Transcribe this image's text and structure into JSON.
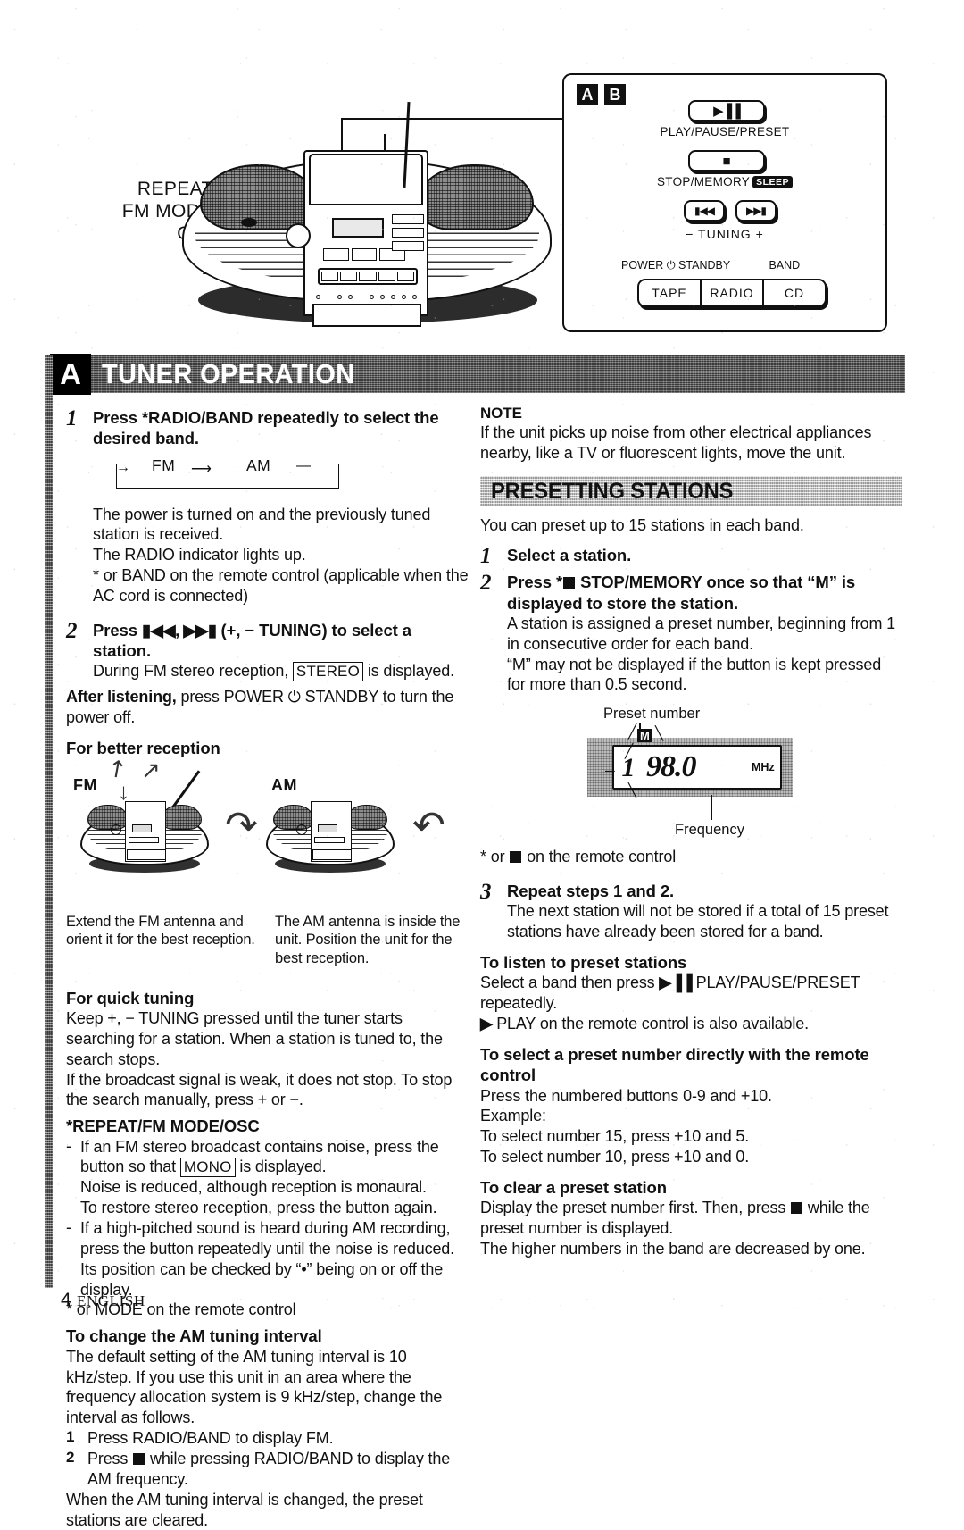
{
  "page": {
    "number": "4",
    "language": "ENGLISH"
  },
  "diagram": {
    "unit_callouts": [
      {
        "name": "repeat-fm-mode-osc",
        "text": "REPEAT/\nFM MODE/\nOSC"
      },
      {
        "name": "headphone-jack",
        "text": "๏"
      }
    ],
    "panel": {
      "badges": [
        "A",
        "B"
      ],
      "keys": [
        {
          "name": "play-pause-preset",
          "glyph": "▶▐▐",
          "caption": "PLAY/PAUSE/PRESET"
        },
        {
          "name": "stop-memory",
          "glyph": "■",
          "caption": "STOP/MEMORY",
          "badge": "SLEEP"
        },
        {
          "name": "tuning-down",
          "glyph": "▮◀◀"
        },
        {
          "name": "tuning-up",
          "glyph": "▶▶▮"
        }
      ],
      "tuning_caption": {
        "minus": "−",
        "label": "TUNING",
        "plus": "+"
      },
      "power_label": "POWER ⏻ STANDBY",
      "band_label": "BAND",
      "source_buttons": [
        "TAPE",
        "RADIO",
        "CD"
      ]
    }
  },
  "section": {
    "badge": "A",
    "title": "TUNER OPERATION"
  },
  "left": {
    "step1": {
      "num": "1",
      "heading": "Press *RADIO/BAND repeatedly to select the desired band.",
      "band_cycle": {
        "fm": "FM",
        "am": "AM"
      },
      "body1": "The power is turned on and the previously tuned station is received.",
      "body2": "The RADIO indicator lights up.",
      "body3": "* or BAND on the remote control (applicable when the AC cord is connected)"
    },
    "step2": {
      "num": "2",
      "heading_pre": "Press ",
      "heading_syms": "▮◀◀, ▶▶▮",
      "heading_post": " (+, − TUNING)  to select a station.",
      "body": "During FM stereo reception, ",
      "boxed": "STEREO",
      "body_after": " is displayed."
    },
    "after_listening": {
      "bold": "After listening,",
      "rest": " press POWER ⏻ STANDBY to turn the power off."
    },
    "better_reception": {
      "heading": "For better reception",
      "fm_label": "FM",
      "am_label": "AM",
      "fm_caption": "Extend the FM antenna and orient it for the best reception.",
      "am_caption": "The AM antenna is inside the unit. Position the unit for the best reception."
    },
    "quick_tuning": {
      "heading": "For quick tuning",
      "body1": "Keep +, − TUNING pressed until the tuner starts searching for a station. When a station is tuned to, the search stops.",
      "body2": "If the broadcast signal is weak, it does not stop. To stop the search manually, press + or −."
    },
    "repeat_mode": {
      "heading": "*REPEAT/FM MODE/OSC",
      "bullet1_a": "If an FM stereo broadcast contains noise, press the button so that ",
      "bullet1_boxed": "MONO",
      "bullet1_b": " is displayed.",
      "bullet1_c": "Noise is reduced, although reception is monaural.",
      "bullet1_d": "To restore stereo reception, press the button again.",
      "bullet2": "If a high-pitched sound is heard during AM recording, press the button repeatedly until the noise is reduced.  Its position can be checked by “•” being on or off the display.",
      "note": "* or MODE on the remote control"
    },
    "am_interval": {
      "heading": "To change the AM tuning interval",
      "body": "The default setting of the AM tuning interval is 10 kHz/step. If you use this unit in an area where the frequency allocation system is 9 kHz/step, change the interval as follows.",
      "item1_num": "1",
      "item1": "Press RADIO/BAND to display FM.",
      "item2_num": "2",
      "item2_pre": "Press ",
      "item2_post": " while pressing RADIO/BAND to display the AM frequency.",
      "closing": "When the AM tuning interval is changed, the preset stations are cleared."
    }
  },
  "right": {
    "note": {
      "heading": "NOTE",
      "body": "If the unit picks up noise from other electrical appliances nearby, like a TV or fluorescent lights, move the unit."
    },
    "presetting": {
      "title": "PRESETTING STATIONS",
      "intro": "You can preset up to 15 stations in each band.",
      "step1": {
        "num": "1",
        "heading": "Select a station."
      },
      "step2": {
        "num": "2",
        "heading_pre": "Press *",
        "heading_post": " STOP/MEMORY once so that “M” is displayed to store the station.",
        "body1": "A station is assigned a preset number, beginning from 1 in consecutive order for each band.",
        "body2": "“M” may not be displayed if the button is kept pressed for more than 0.5 second."
      },
      "display_figure": {
        "preset_label": "Preset number",
        "frequency_label": "Frequency",
        "preset_value": "1",
        "memory_indicator": "M",
        "frequency_value": "98.0",
        "unit": "MHz"
      },
      "remote_note_pre": "* or ",
      "remote_note_post": " on the remote control",
      "step3": {
        "num": "3",
        "heading": "Repeat steps 1 and 2.",
        "body": "The next station will not be stored if a total of 15 preset stations have already been stored for a band."
      },
      "listen": {
        "heading": "To listen to preset stations",
        "body_pre": "Select a band then press ",
        "body_sym": "▶▐▐",
        "body_post": " PLAY/PAUSE/PRESET repeatedly.",
        "body2_sym": "▶",
        "body2": " PLAY on the remote control is also available."
      },
      "direct": {
        "heading": "To select a preset number directly with the remote control",
        "body1": "Press the numbered buttons 0-9 and +10.",
        "body2": "Example:",
        "body3": "To select number 15, press +10 and 5.",
        "body4": "To select number 10, press +10 and 0."
      },
      "clear": {
        "heading": "To clear a preset station",
        "body_pre": "Display the preset number first.  Then, press ",
        "body_post": " while the preset number is displayed.",
        "body2": "The higher numbers in the band are decreased by one."
      }
    }
  }
}
